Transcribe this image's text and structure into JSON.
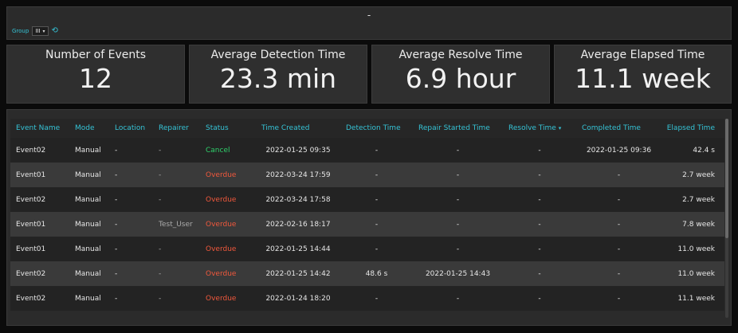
{
  "header": {
    "title": "-",
    "group_label": "Group",
    "group_value": "III",
    "caret": "▾",
    "refresh_glyph": "⟲"
  },
  "stats": [
    {
      "label": "Number of Events",
      "value": "12"
    },
    {
      "label": "Average Detection Time",
      "value": "23.3 min"
    },
    {
      "label": "Average Resolve Time",
      "value": "6.9 hour"
    },
    {
      "label": "Average Elapsed Time",
      "value": "11.1 week"
    }
  ],
  "table": {
    "columns": [
      "Event Name",
      "Mode",
      "Location",
      "Repairer",
      "Status",
      "Time Created",
      "Detection Time",
      "Repair Started Time",
      "Resolve Time",
      "Completed Time",
      "Elapsed Time"
    ],
    "sort_indicator": "▾",
    "rows": [
      [
        "Event02",
        "Manual",
        "-",
        "-",
        "Cancel",
        "2022-01-25 09:35",
        "-",
        "-",
        "-",
        "2022-01-25 09:36",
        "42.4 s"
      ],
      [
        "Event01",
        "Manual",
        "-",
        "-",
        "Overdue",
        "2022-03-24 17:59",
        "-",
        "-",
        "-",
        "-",
        "2.7 week"
      ],
      [
        "Event02",
        "Manual",
        "-",
        "-",
        "Overdue",
        "2022-03-24 17:58",
        "-",
        "-",
        "-",
        "-",
        "2.7 week"
      ],
      [
        "Event01",
        "Manual",
        "-",
        "Test_User",
        "Overdue",
        "2022-02-16 18:17",
        "-",
        "-",
        "-",
        "-",
        "7.8 week"
      ],
      [
        "Event01",
        "Manual",
        "-",
        "-",
        "Overdue",
        "2022-01-25 14:44",
        "-",
        "-",
        "-",
        "-",
        "11.0 week"
      ],
      [
        "Event02",
        "Manual",
        "-",
        "-",
        "Overdue",
        "2022-01-25 14:42",
        "48.6 s",
        "2022-01-25 14:43",
        "-",
        "-",
        "11.0 week"
      ],
      [
        "Event02",
        "Manual",
        "-",
        "-",
        "Overdue",
        "2022-01-24 18:20",
        "-",
        "-",
        "-",
        "-",
        "11.1 week"
      ]
    ]
  },
  "colors": {
    "accent": "#35c3d6",
    "cancel": "#2fd06b",
    "overdue": "#f0583c"
  }
}
